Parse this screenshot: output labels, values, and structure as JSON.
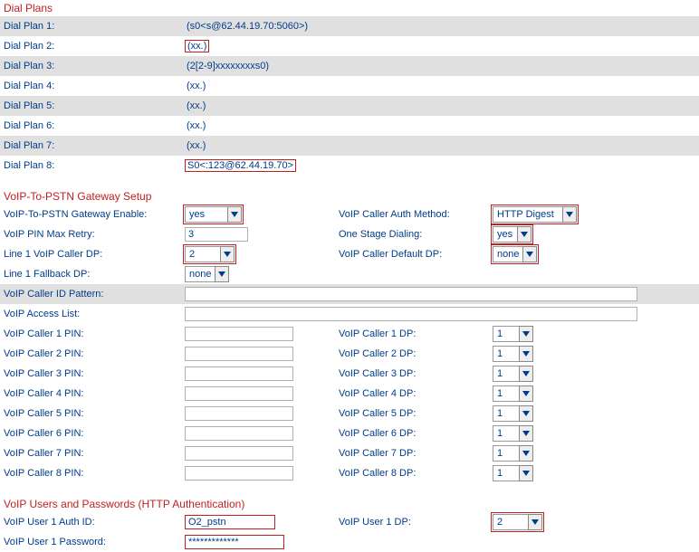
{
  "sections": {
    "dial_plans": "Dial Plans",
    "voip_gw": "VoIP-To-PSTN Gateway Setup",
    "voip_users": "VoIP Users and Passwords (HTTP Authentication)"
  },
  "dial_plans": [
    {
      "label": "Dial Plan 1:",
      "value": "(s0<s@62.44.19.70:5060>)",
      "boxed": false
    },
    {
      "label": "Dial Plan 2:",
      "value": "(xx.)",
      "boxed": true
    },
    {
      "label": "Dial Plan 3:",
      "value": "(2[2-9]xxxxxxxxs0)",
      "boxed": false
    },
    {
      "label": "Dial Plan 4:",
      "value": "(xx.)",
      "boxed": false
    },
    {
      "label": "Dial Plan 5:",
      "value": "(xx.)",
      "boxed": false
    },
    {
      "label": "Dial Plan 6:",
      "value": "(xx.)",
      "boxed": false
    },
    {
      "label": "Dial Plan 7:",
      "value": "(xx.)",
      "boxed": false
    },
    {
      "label": "Dial Plan 8:",
      "value": "S0<:123@62.44.19.70>",
      "boxed": true
    }
  ],
  "gw": {
    "enable": {
      "label": "VoIP-To-PSTN Gateway Enable:",
      "value": "yes",
      "boxed": true
    },
    "auth_method": {
      "label": "VoIP Caller Auth Method:",
      "value": "HTTP Digest",
      "boxed": true
    },
    "pin_retry": {
      "label": "VoIP PIN Max Retry:",
      "value": "3"
    },
    "one_stage": {
      "label": "One Stage Dialing:",
      "value": "yes",
      "boxed": true
    },
    "line1_dp": {
      "label": "Line 1 VoIP Caller DP:",
      "value": "2",
      "boxed": true
    },
    "default_dp": {
      "label": "VoIP Caller Default DP:",
      "value": "none",
      "boxed": true
    },
    "line1_fb": {
      "label": "Line 1 Fallback DP:",
      "value": "none",
      "boxed": false
    },
    "cid_pattern": {
      "label": "VoIP Caller ID Pattern:",
      "value": ""
    },
    "access_list": {
      "label": "VoIP Access List:",
      "value": ""
    }
  },
  "callers": [
    {
      "pin_label": "VoIP Caller 1 PIN:",
      "pin": "",
      "dp_label": "VoIP Caller 1 DP:",
      "dp": "1"
    },
    {
      "pin_label": "VoIP Caller 2 PIN:",
      "pin": "",
      "dp_label": "VoIP Caller 2 DP:",
      "dp": "1"
    },
    {
      "pin_label": "VoIP Caller 3 PIN:",
      "pin": "",
      "dp_label": "VoIP Caller 3 DP:",
      "dp": "1"
    },
    {
      "pin_label": "VoIP Caller 4 PIN:",
      "pin": "",
      "dp_label": "VoIP Caller 4 DP:",
      "dp": "1"
    },
    {
      "pin_label": "VoIP Caller 5 PIN:",
      "pin": "",
      "dp_label": "VoIP Caller 5 DP:",
      "dp": "1"
    },
    {
      "pin_label": "VoIP Caller 6 PIN:",
      "pin": "",
      "dp_label": "VoIP Caller 6 DP:",
      "dp": "1"
    },
    {
      "pin_label": "VoIP Caller 7 PIN:",
      "pin": "",
      "dp_label": "VoIP Caller 7 DP:",
      "dp": "1"
    },
    {
      "pin_label": "VoIP Caller 8 PIN:",
      "pin": "",
      "dp_label": "VoIP Caller 8 DP:",
      "dp": "1"
    }
  ],
  "users": {
    "u1_auth": {
      "label": "VoIP User 1 Auth ID:",
      "value": "O2_pstn",
      "boxed": true
    },
    "u1_dp": {
      "label": "VoIP User 1 DP:",
      "value": "2",
      "boxed": true
    },
    "u1_pw": {
      "label": "VoIP User 1 Password:",
      "value": "*************",
      "boxed": true
    }
  }
}
